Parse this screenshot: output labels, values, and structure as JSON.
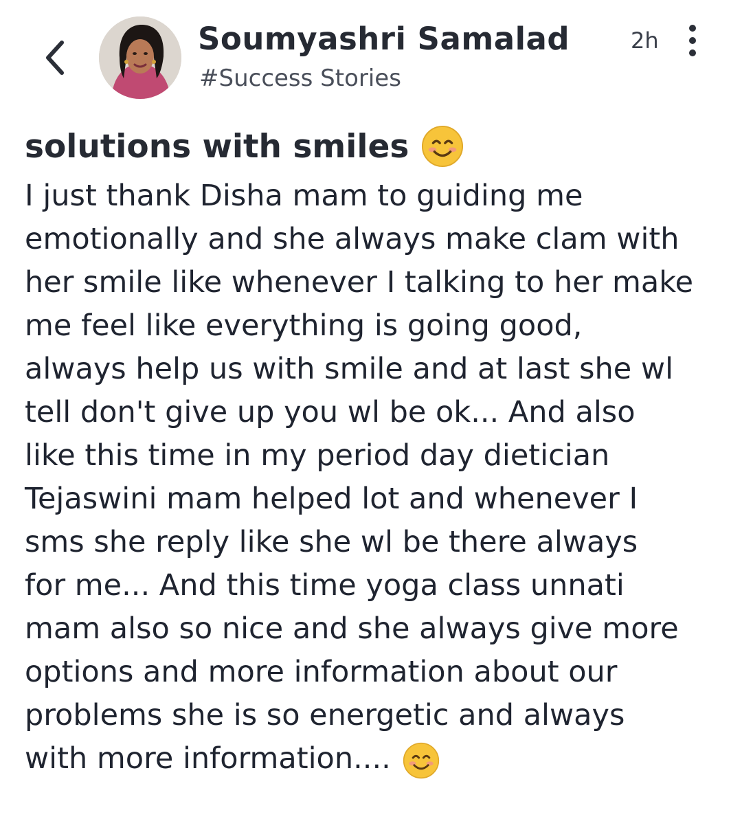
{
  "header": {
    "author_name": "Soumyashri Samalad",
    "category": "#Success Stories",
    "timestamp": "2h",
    "back_icon": "chevron-left-icon",
    "more_icon": "more-vertical-icon"
  },
  "post": {
    "title": "solutions with smiles",
    "body_lines": [
      "I just thank Disha mam to guiding me",
      "emotionally and she always make clam with",
      "her smile like whenever I talking to her make",
      "me feel like everything is going good,",
      "always help us with smile and at last she wl",
      "tell don't give up you wl be ok... And also",
      "like this time in my period day dietician",
      "Tejaswini mam helped lot and whenever I",
      "sms she reply like she wl be there always",
      "for me... And this time yoga class unnati",
      "mam also so nice and she always give more",
      "options and more information about our",
      "problems she is so energetic and always",
      "with more information...."
    ],
    "emoji": "smiling-face-emoji"
  },
  "colors": {
    "text": "#1f2430",
    "emoji_face": "#f7c43a"
  }
}
